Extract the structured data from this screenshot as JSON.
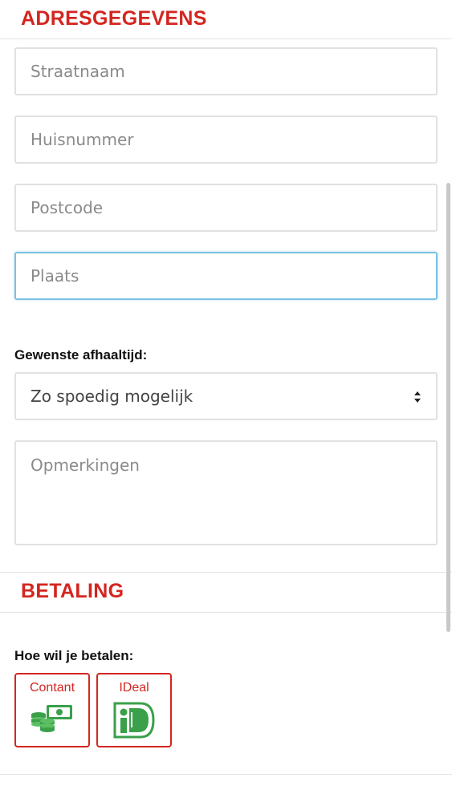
{
  "address": {
    "title": "ADRESGEGEVENS",
    "street_placeholder": "Straatnaam",
    "house_number_placeholder": "Huisnummer",
    "postcode_placeholder": "Postcode",
    "city_placeholder": "Plaats"
  },
  "pickup": {
    "label": "Gewenste afhaaltijd:",
    "selected": "Zo spoedig mogelijk"
  },
  "remarks": {
    "placeholder": "Opmerkingen"
  },
  "payment": {
    "title": "BETALING",
    "question": "Hoe wil je betalen:",
    "options": [
      {
        "label": "Contant",
        "icon": "cash-icon"
      },
      {
        "label": "IDeal",
        "icon": "ideal-logo-icon"
      }
    ]
  },
  "colors": {
    "accent": "#d32620",
    "focus": "#7cc1df",
    "icon_green": "#3aa04a"
  }
}
